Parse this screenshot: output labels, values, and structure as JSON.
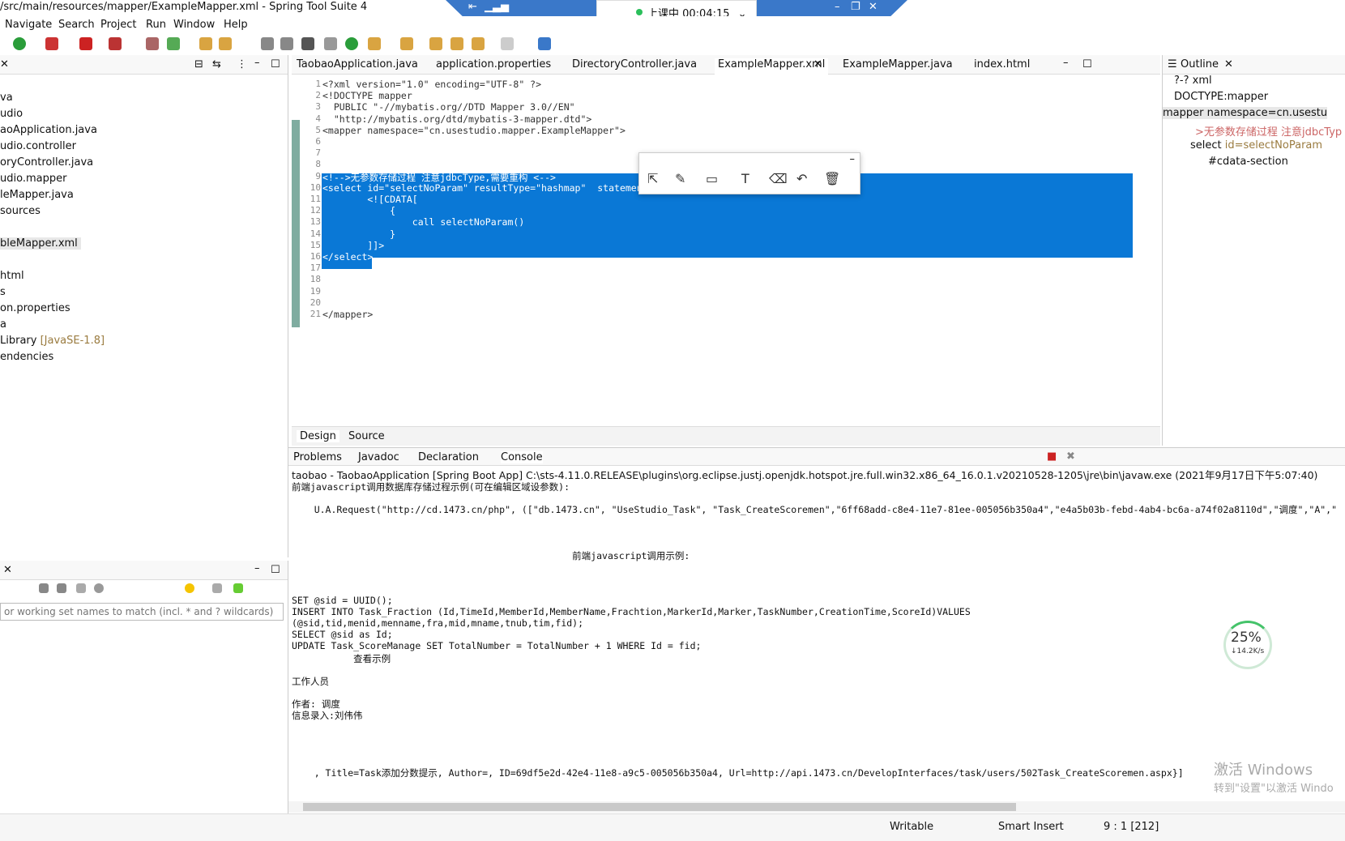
{
  "window": {
    "title": "/src/main/resources/mapper/ExampleMapper.xml - Spring Tool Suite 4"
  },
  "menu": [
    "Navigate",
    "Search",
    "Project",
    "Run",
    "Window",
    "Help"
  ],
  "recording": {
    "status": "上课中 00:04:15"
  },
  "left_tree": [
    "va",
    "udio",
    "aoApplication.java",
    "udio.controller",
    "oryController.java",
    "udio.mapper",
    "leMapper.java",
    "sources",
    "",
    "bleMapper.xml",
    "",
    "html",
    "s",
    "on.properties",
    "a",
    "Library",
    "endencies"
  ],
  "left_tree_extra": {
    "jre_suffix": "[JavaSE-1.8]"
  },
  "filter_placeholder": "or working set names to match (incl. * and ? wildcards)",
  "editor": {
    "tabs": [
      "TaobaoApplication.java",
      "application.properties",
      "DirectoryController.java",
      "ExampleMapper.xml",
      "ExampleMapper.java",
      "index.html"
    ],
    "active_tab": "ExampleMapper.xml",
    "lines": [
      "<?xml version=\"1.0\" encoding=\"UTF-8\" ?>",
      "<!DOCTYPE mapper",
      "  PUBLIC \"-//mybatis.org//DTD Mapper 3.0//EN\"",
      "  \"http://mybatis.org/dtd/mybatis-3-mapper.dtd\">",
      "<mapper namespace=\"cn.usestudio.mapper.ExampleMapper\">",
      "",
      "",
      "",
      "<!-->无参数存储过程 注意jdbcType,需要重构 <-->",
      "<select id=\"selectNoParam\" resultType=\"hashmap\"  statementType=\"CALLABLE\" parameterType=\"map\">",
      "        <![CDATA[",
      "            {",
      "                call selectNoParam()",
      "            }",
      "        ]]>",
      "</select>",
      "",
      "",
      "",
      "",
      "</mapper>"
    ],
    "bottom_tabs": [
      "Design",
      "Source"
    ]
  },
  "outline": {
    "title": "Outline",
    "items": [
      "?-? xml",
      "DOCTYPE:mapper",
      "mapper namespace=cn.usestu",
      ">无参数存储过程 注意jdbcTyp",
      "select",
      "#cdata-section"
    ],
    "select_attr": "id=selectNoParam"
  },
  "console_panel": {
    "tabs": [
      "Problems",
      "Javadoc",
      "Declaration",
      "Console"
    ],
    "header": "taobao - TaobaoApplication [Spring Boot App] C:\\sts-4.11.0.RELEASE\\plugins\\org.eclipse.justj.openjdk.hotspot.jre.full.win32.x86_64_16.0.1.v20210528-1205\\jre\\bin\\javaw.exe  (2021年9月17日下午5:07:40)",
    "lines": [
      "前端javascript调用数据库存储过程示例(可在编辑区域设参数):",
      "",
      "    U.A.Request(\"http://cd.1473.cn/php\", ([\"db.1473.cn\", \"UseStudio_Task\", \"Task_CreateScoremen\",\"6ff68add-c8e4-11e7-81ee-005056b350a4\",\"e4a5b03b-febd-4ab4-bc6a-a74f02a8110d\",\"调度\",\"A\",\"",
      "",
      "",
      "",
      "                                                  前端javascript调用示例:",
      "",
      "",
      "",
      "SET @sid = UUID();",
      "INSERT INTO Task_Fraction (Id,TimeId,MemberId,MemberName,Frachtion,MarkerId,Marker,TaskNumber,CreationTime,ScoreId)VALUES",
      "(@sid,tid,menid,menname,fra,mid,mname,tnub,tim,fid);",
      "SELECT @sid as Id;",
      "UPDATE Task_ScoreManage SET TotalNumber = TotalNumber + 1 WHERE Id = fid;",
      "           查看示例",
      "",
      "工作人员",
      "",
      "作者: 调度",
      "信息录入:刘伟伟",
      "",
      "",
      "",
      "",
      "    , Title=Task添加分数提示, Author=, ID=69df5e2d-42e4-11e8-a9c5-005056b350a4, Url=http://api.1473.cn/DevelopInterfaces/task/users/502Task_CreateScoremen.aspx}]"
    ]
  },
  "status": {
    "writable": "Writable",
    "insert_mode": "Smart Insert",
    "position": "9 : 1 [212]"
  },
  "speed_widget": {
    "percent": "25%",
    "rate": "↓14.2K/s"
  },
  "watermark": {
    "line1": "激活 Windows",
    "line2": "转到\"设置\"以激活 Windo"
  }
}
